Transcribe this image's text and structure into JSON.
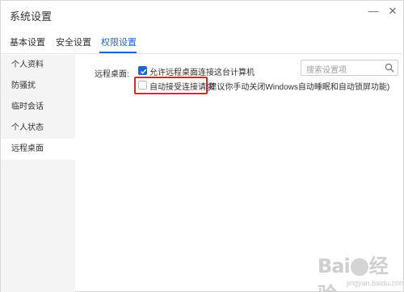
{
  "window": {
    "title": "系统设置"
  },
  "tabs": [
    {
      "label": "基本设置"
    },
    {
      "label": "安全设置"
    },
    {
      "label": "权限设置",
      "active": true
    }
  ],
  "search": {
    "placeholder": "搜索设置项"
  },
  "sidebar": {
    "items": [
      {
        "label": "个人资料"
      },
      {
        "label": "防骚扰"
      },
      {
        "label": "临时会话"
      },
      {
        "label": "个人状态"
      },
      {
        "label": "远程桌面",
        "active": true
      }
    ]
  },
  "remote_desktop": {
    "label": "远程桌面:",
    "allow_connect": {
      "label": "允许远程桌面连接这台计算机",
      "checked": true
    },
    "auto_accept": {
      "label": "自动接受连接请求",
      "checked": false
    },
    "auto_accept_hint": "(建议你手动关闭Windows自动睡眠和自动锁屏功能)"
  },
  "watermark": {
    "logo": "Bai du",
    "sub": "jingyan.baidu.com"
  },
  "colors": {
    "accent": "#1a66d9",
    "highlight": "#e0271f",
    "sidebar_bg": "#f4f4f4"
  }
}
